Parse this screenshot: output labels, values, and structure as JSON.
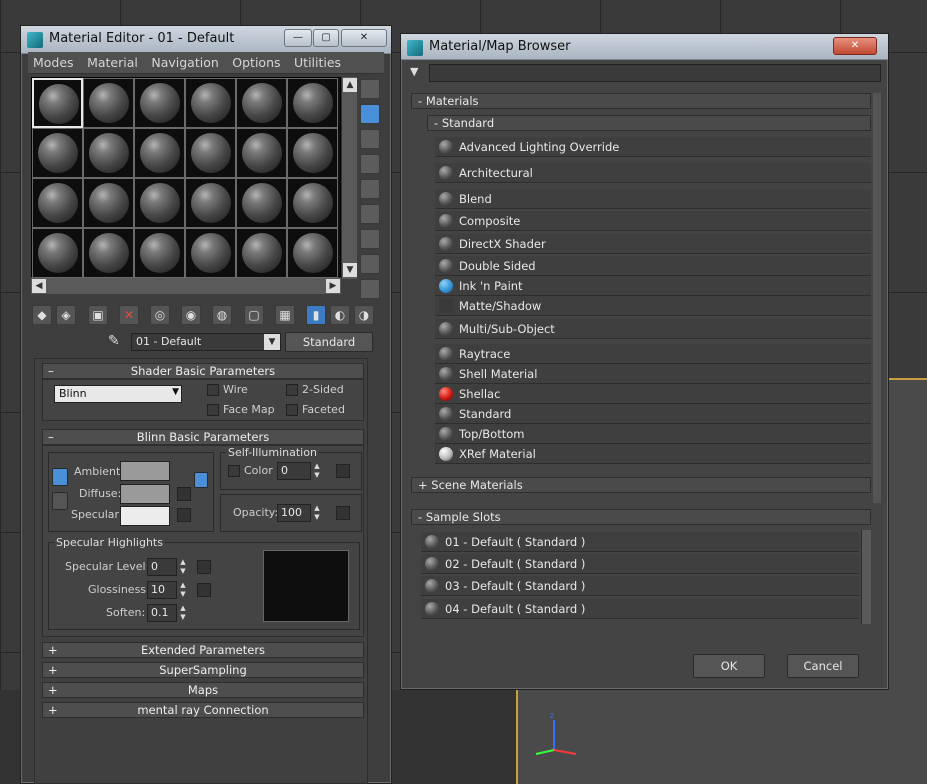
{
  "material_editor": {
    "title": "Material Editor - 01 - Default",
    "window_buttons": [
      "—",
      "▢",
      "✕"
    ],
    "menu": [
      "Modes",
      "Material",
      "Navigation",
      "Options",
      "Utilities"
    ],
    "material_name": "01 - Default",
    "material_type_button": "Standard",
    "shader_rollout": {
      "title": "Shader Basic Parameters",
      "shader": "Blinn",
      "wire": "Wire",
      "two_sided": "2-Sided",
      "face_map": "Face Map",
      "faceted": "Faceted"
    },
    "blinn_rollout": {
      "title": "Blinn Basic Parameters",
      "self_illumination": "Self-Illumination",
      "color_label": "Color",
      "color_value": "0",
      "ambient": "Ambient:",
      "diffuse": "Diffuse:",
      "specular": "Specular:",
      "opacity_label": "Opacity:",
      "opacity_value": "100",
      "specular_highlights": "Specular Highlights",
      "specular_level_label": "Specular Level:",
      "specular_level_value": "0",
      "glossiness_label": "Glossiness:",
      "glossiness_value": "10",
      "soften_label": "Soften:",
      "soften_value": "0.1"
    },
    "collapsed_rollouts": [
      "Extended Parameters",
      "SuperSampling",
      "Maps",
      "mental ray Connection"
    ],
    "colors": {
      "ambient": "#9a9a9a",
      "diffuse": "#9a9a9a",
      "specular": "#ececec"
    }
  },
  "browser": {
    "title": "Material/Map Browser",
    "window_buttons": [
      "✕"
    ],
    "materials_group": "Materials",
    "standard_group": "Standard",
    "materials": [
      {
        "name": "Advanced Lighting Override",
        "ball": "grey"
      },
      {
        "name": "Architectural",
        "ball": "grey"
      },
      {
        "name": "Blend",
        "ball": "grey"
      },
      {
        "name": "Composite",
        "ball": "grey"
      },
      {
        "name": "DirectX Shader",
        "ball": "grey"
      },
      {
        "name": "Double Sided",
        "ball": "grey"
      },
      {
        "name": "Ink 'n Paint",
        "ball": "blue"
      },
      {
        "name": "Matte/Shadow",
        "ball": "none"
      },
      {
        "name": "Multi/Sub-Object",
        "ball": "grey"
      },
      {
        "name": "Raytrace",
        "ball": "grey"
      },
      {
        "name": "Shell Material",
        "ball": "grey"
      },
      {
        "name": "Shellac",
        "ball": "red"
      },
      {
        "name": "Standard",
        "ball": "grey"
      },
      {
        "name": "Top/Bottom",
        "ball": "grey"
      },
      {
        "name": "XRef Material",
        "ball": "white"
      }
    ],
    "scene_materials_group": "Scene Materials",
    "sample_slots_group": "Sample Slots",
    "sample_slots": [
      "01 - Default  ( Standard )",
      "02 - Default  ( Standard )",
      "03 - Default  ( Standard )",
      "04 - Default  ( Standard )"
    ],
    "ok": "OK",
    "cancel": "Cancel"
  }
}
